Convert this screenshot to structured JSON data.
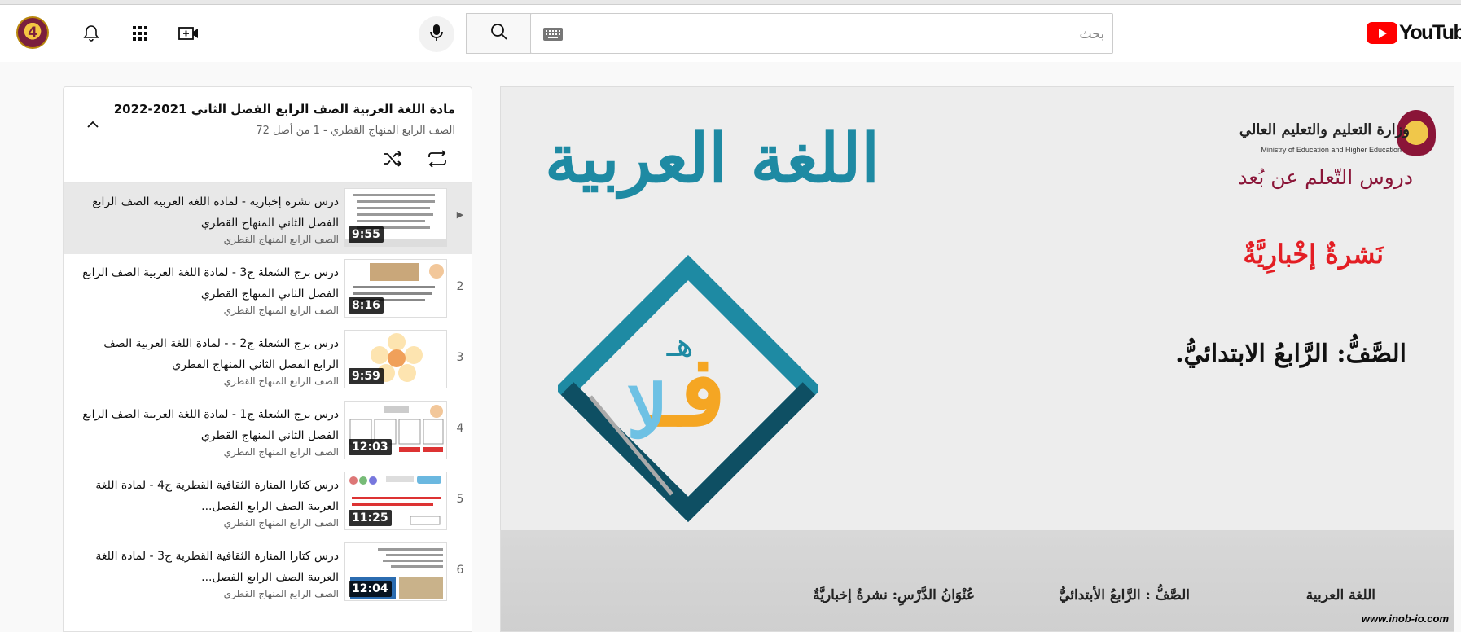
{
  "header": {
    "logo_text": "YouTube",
    "search": {
      "placeholder": "بحث",
      "value": ""
    },
    "avatar_text": "4"
  },
  "icons": {
    "notifications": "bell-icon",
    "apps": "apps-grid-icon",
    "create": "video-plus-icon",
    "mic": "mic-icon",
    "search": "search-icon",
    "keyboard": "keyboard-icon",
    "collapse": "chevron-up-icon",
    "loop": "loop-icon",
    "shuffle": "shuffle-icon",
    "now_playing": "play-indicator-icon"
  },
  "playlist": {
    "title": "مادة اللغة العربية الصف الرابع الفصل الثاني 2021-2022",
    "subtitle": "الصف الرابع المنهاج القطري - 1 من أصل 72",
    "items": [
      {
        "index": "▶",
        "title": "درس نشرة إخبارية - لمادة اللغة العربية الصف الرابع الفصل الثاني المنهاج القطري",
        "channel": "الصف الرابع المنهاج القطري",
        "duration": "9:55"
      },
      {
        "index": "2",
        "title": "درس برج الشعلة ج3 - لمادة اللغة العربية الصف الرابع الفصل الثاني المنهاج القطري",
        "channel": "الصف الرابع المنهاج القطري",
        "duration": "8:16"
      },
      {
        "index": "3",
        "title": "درس برج الشعلة ج2 - - لمادة اللغة العربية الصف الرابع الفصل الثاني المنهاج القطري",
        "channel": "الصف الرابع المنهاج القطري",
        "duration": "9:59"
      },
      {
        "index": "4",
        "title": "درس برج الشعلة ج1 - لمادة اللغة العربية الصف الرابع الفصل الثاني المنهاج القطري",
        "channel": "الصف الرابع المنهاج القطري",
        "duration": "12:03"
      },
      {
        "index": "5",
        "title": "درس كتارا المنارة الثقافية القطرية ج4 - لمادة اللغة العربية الصف الرابع الفصل...",
        "channel": "الصف الرابع المنهاج القطري",
        "duration": "11:25"
      },
      {
        "index": "6",
        "title": "درس كتارا المنارة الثقافية القطرية ج3 - لمادة اللغة العربية الصف الرابع الفصل...",
        "channel": "الصف الرابع المنهاج القطري",
        "duration": "12:04"
      }
    ]
  },
  "video": {
    "ministry_ar": "وزارة التعليم والتعليم العالي",
    "ministry_en": "Ministry of Education and Higher Education",
    "remote_learning": "دروس التّعلم عن بُعد",
    "lesson_title": "نَشرةٌ إخْبارِيَّةٌ",
    "grade": "الصَّفُّ: الرَّابعُ الابتدائيُّ.",
    "subject_art": "اللغة العربية",
    "bottom_subject": "اللغة العربية",
    "bottom_grade": "الصَّفُّ : الرَّابعُ الأبتدائيُّ",
    "bottom_lesson": "عُنْوَانُ الدَّرْسِ: نشرةٌ إخباريَّةٌ",
    "watermark": "www.inob-io.com"
  },
  "colors": {
    "accent_red": "#ff0000",
    "lesson_red": "#e31e24",
    "maroon": "#8a1538",
    "teal": "#1e8aa3"
  }
}
